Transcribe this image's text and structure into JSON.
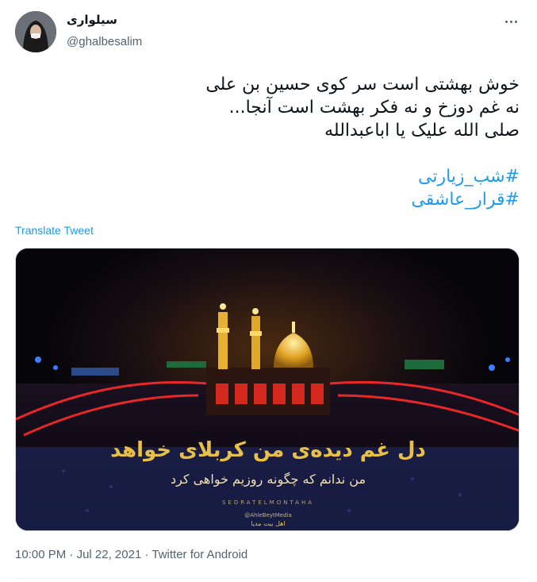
{
  "author": {
    "display_name": "سیلواری",
    "handle": "@ghalbesalim"
  },
  "tweet": {
    "lines": [
      "خوش بهشتی است سر کوی حسین بن علی",
      "نه غم دوزخ و نه فکر بهشت است آنجا...",
      "صلی الله علیک یا اباعبدالله"
    ],
    "hashtags": [
      "#شب_زیارتی",
      "#قرار_عاشقی"
    ],
    "translate_label": "Translate Tweet"
  },
  "media": {
    "calligraphy_line1": "دل غم دیده‌ی من کربلای خواهد",
    "calligraphy_line2": "من ندانم که چگونه روزیم خواهی کرد",
    "watermark": "SEDRATELMONTAHA",
    "brand_handle": "@AhleBeytMedia",
    "brand_name": "اهل بیت مدیا"
  },
  "footer": {
    "time": "10:00 PM",
    "separator": "·",
    "date": "Jul 22, 2021",
    "source": "Twitter for Android"
  },
  "icons": {
    "more": "more-dots-icon"
  },
  "colors": {
    "link": "#1d9bf0",
    "muted": "#536471",
    "text": "#0f1419"
  }
}
